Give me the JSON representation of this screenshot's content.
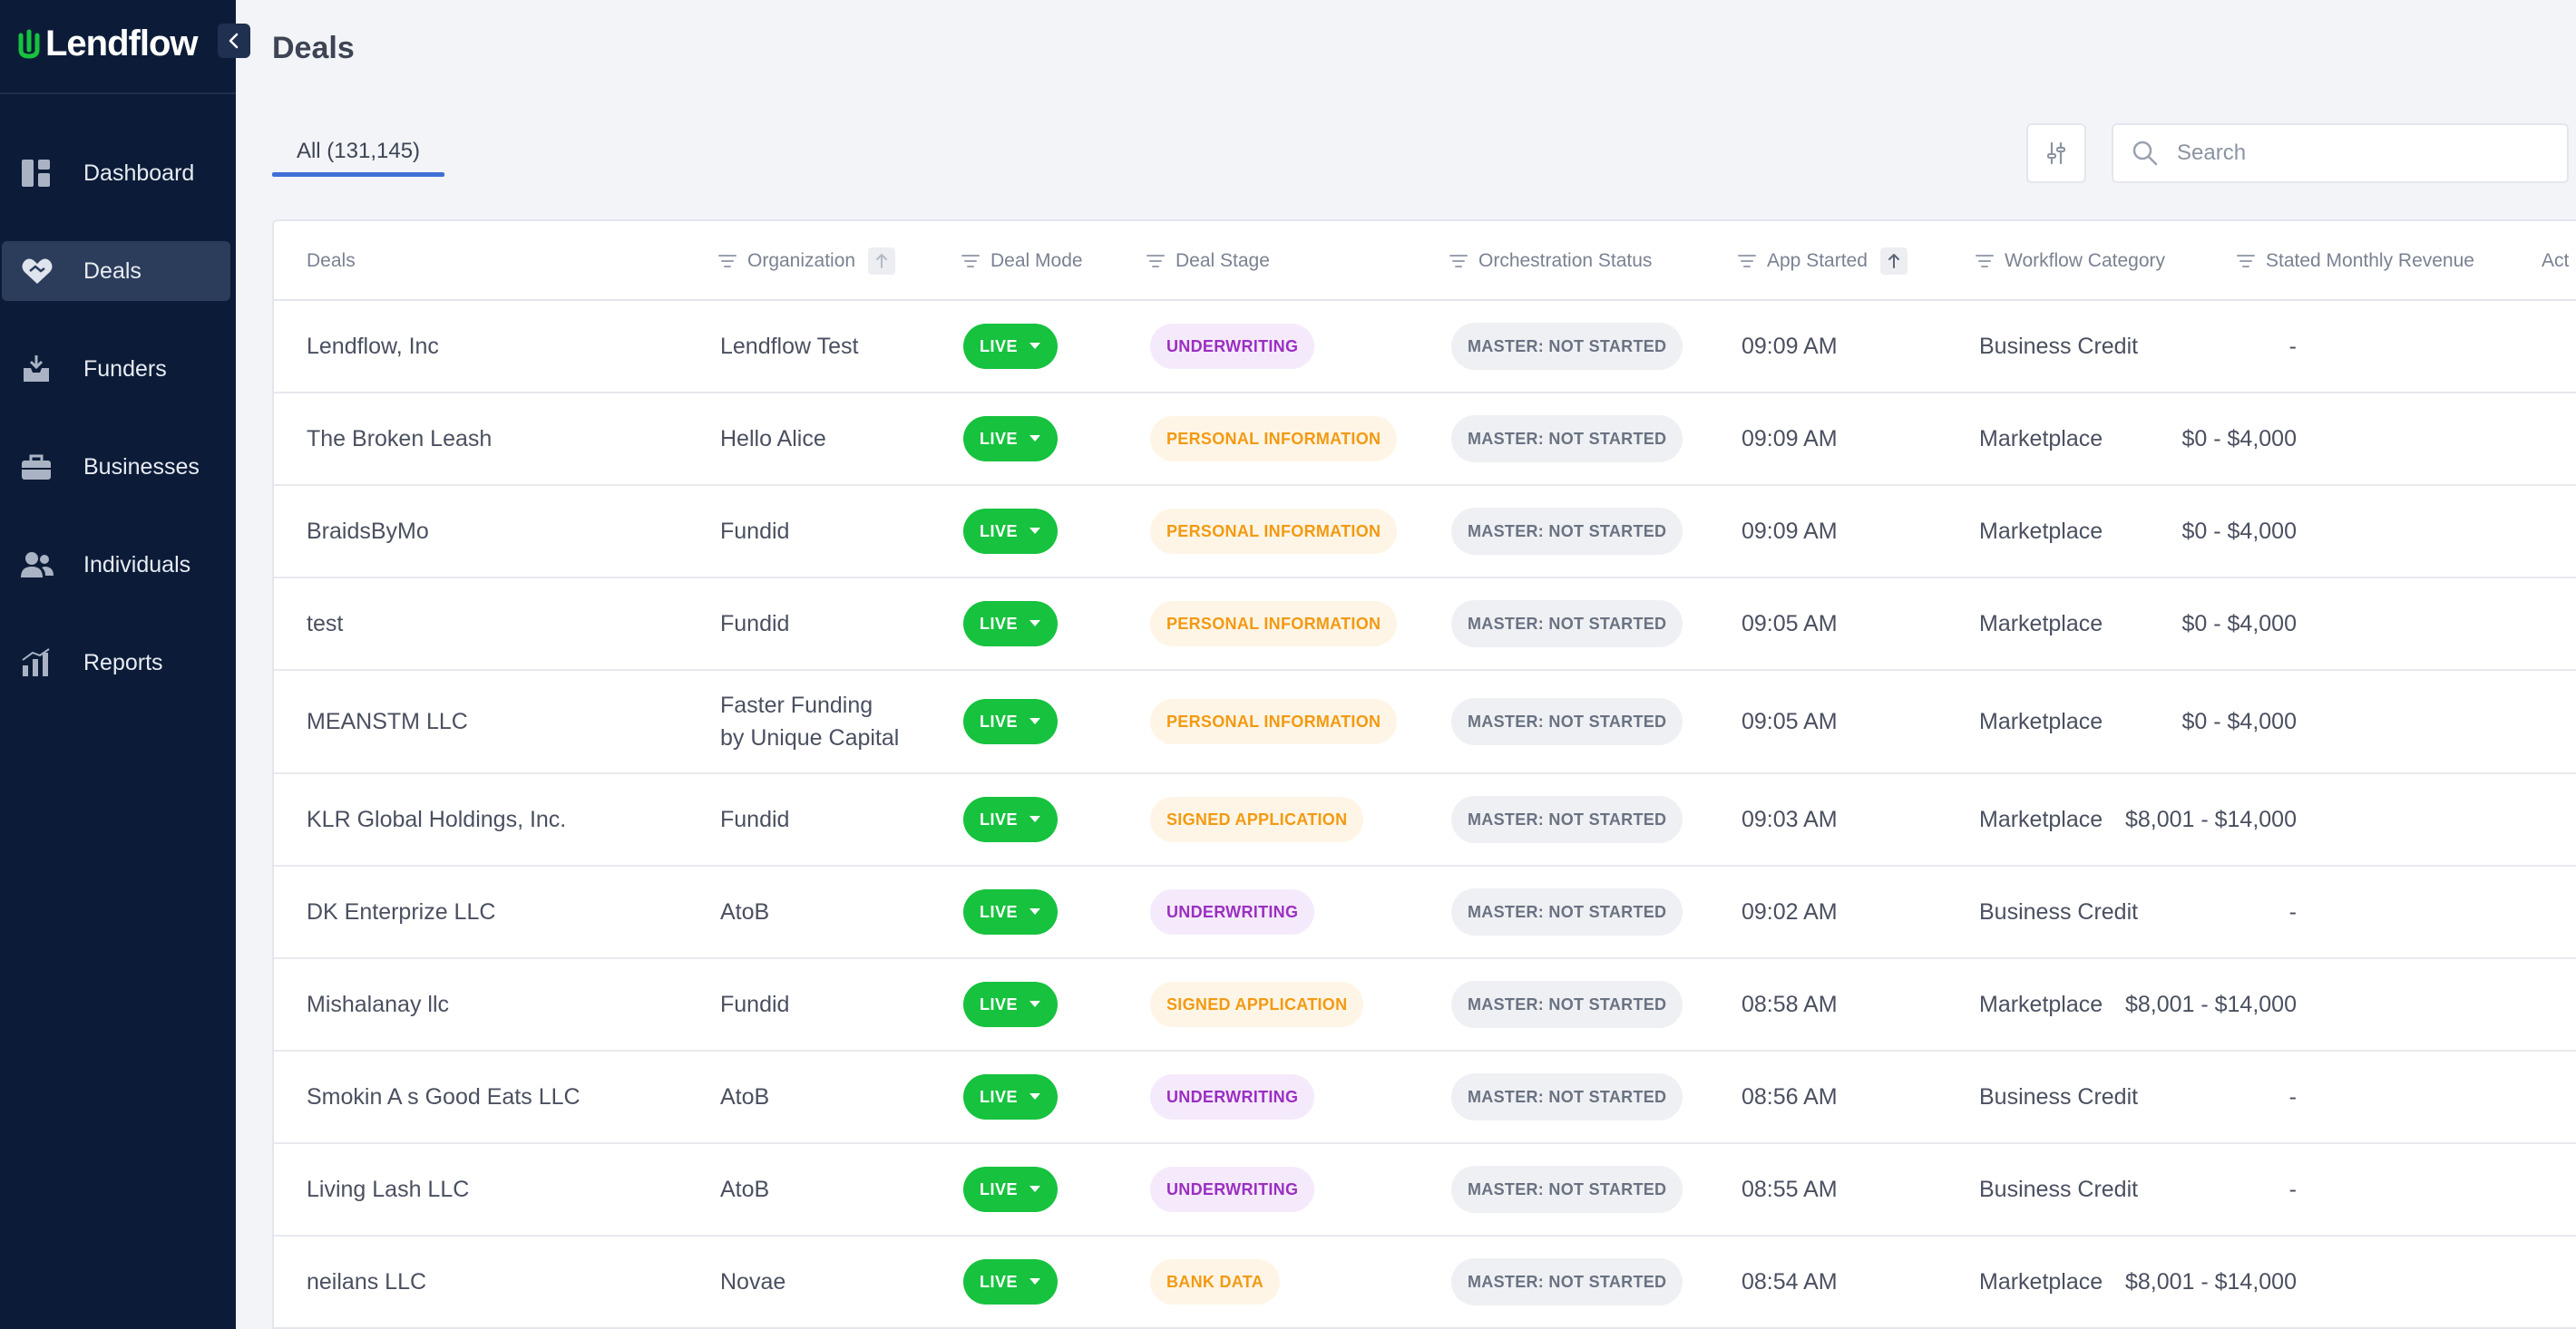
{
  "sidebar": {
    "brand": "Lendflow",
    "items": [
      {
        "label": "Dashboard",
        "icon": "dashboard-icon"
      },
      {
        "label": "Deals",
        "icon": "handshake-icon",
        "active": true
      },
      {
        "label": "Funders",
        "icon": "inbox-icon"
      },
      {
        "label": "Businesses",
        "icon": "briefcase-icon"
      },
      {
        "label": "Individuals",
        "icon": "users-icon"
      },
      {
        "label": "Reports",
        "icon": "bar-chart-icon"
      }
    ]
  },
  "header": {
    "title": "Deals"
  },
  "tabs": [
    {
      "label": "All (131,145)",
      "active": true
    }
  ],
  "search": {
    "placeholder": "Search",
    "value": ""
  },
  "table": {
    "columns": [
      "Deals",
      "Organization",
      "Deal Mode",
      "Deal Stage",
      "Orchestration Status",
      "App Started",
      "Workflow Category",
      "Stated Monthly Revenue",
      "Act"
    ],
    "rows": [
      {
        "deal": "Lendflow, Inc",
        "org": "Lendflow Test",
        "mode": "LIVE",
        "stage": "UNDERWRITING",
        "stage_color": "purple",
        "orch": "MASTER: NOT STARTED",
        "started": "09:09 AM",
        "category": "Business Credit",
        "revenue": "-"
      },
      {
        "deal": "The Broken Leash",
        "org": "Hello Alice",
        "mode": "LIVE",
        "stage": "PERSONAL INFORMATION",
        "stage_color": "orange",
        "orch": "MASTER: NOT STARTED",
        "started": "09:09 AM",
        "category": "Marketplace",
        "revenue": "$0 - $4,000"
      },
      {
        "deal": "BraidsByMo",
        "org": "Fundid",
        "mode": "LIVE",
        "stage": "PERSONAL INFORMATION",
        "stage_color": "orange",
        "orch": "MASTER: NOT STARTED",
        "started": "09:09 AM",
        "category": "Marketplace",
        "revenue": "$0 - $4,000"
      },
      {
        "deal": "test",
        "org": "Fundid",
        "mode": "LIVE",
        "stage": "PERSONAL INFORMATION",
        "stage_color": "orange",
        "orch": "MASTER: NOT STARTED",
        "started": "09:05 AM",
        "category": "Marketplace",
        "revenue": "$0 - $4,000"
      },
      {
        "deal": "MEANSTM LLC",
        "org": "Faster Funding by Unique Capital",
        "mode": "LIVE",
        "stage": "PERSONAL INFORMATION",
        "stage_color": "orange",
        "orch": "MASTER: NOT STARTED",
        "started": "09:05 AM",
        "category": "Marketplace",
        "revenue": "$0 - $4,000"
      },
      {
        "deal": "KLR Global Holdings, Inc.",
        "org": "Fundid",
        "mode": "LIVE",
        "stage": "SIGNED APPLICATION",
        "stage_color": "orange",
        "orch": "MASTER: NOT STARTED",
        "started": "09:03 AM",
        "category": "Marketplace",
        "revenue": "$8,001 - $14,000"
      },
      {
        "deal": "DK Enterprize LLC",
        "org": "AtoB",
        "mode": "LIVE",
        "stage": "UNDERWRITING",
        "stage_color": "purple",
        "orch": "MASTER: NOT STARTED",
        "started": "09:02 AM",
        "category": "Business Credit",
        "revenue": "-"
      },
      {
        "deal": "Mishalanay llc",
        "org": "Fundid",
        "mode": "LIVE",
        "stage": "SIGNED APPLICATION",
        "stage_color": "orange",
        "orch": "MASTER: NOT STARTED",
        "started": "08:58 AM",
        "category": "Marketplace",
        "revenue": "$8,001 - $14,000"
      },
      {
        "deal": "Smokin A s Good Eats LLC",
        "org": "AtoB",
        "mode": "LIVE",
        "stage": "UNDERWRITING",
        "stage_color": "purple",
        "orch": "MASTER: NOT STARTED",
        "started": "08:56 AM",
        "category": "Business Credit",
        "revenue": "-"
      },
      {
        "deal": "Living Lash LLC",
        "org": "AtoB",
        "mode": "LIVE",
        "stage": "UNDERWRITING",
        "stage_color": "purple",
        "orch": "MASTER: NOT STARTED",
        "started": "08:55 AM",
        "category": "Business Credit",
        "revenue": "-"
      },
      {
        "deal": "neilans LLC",
        "org": "Novae",
        "mode": "LIVE",
        "stage": "BANK DATA",
        "stage_color": "orange",
        "orch": "MASTER: NOT STARTED",
        "started": "08:54 AM",
        "category": "Marketplace",
        "revenue": "$8,001 - $14,000"
      }
    ]
  },
  "colors": {
    "sidebar_bg": "#0c1c38",
    "accent": "#3f6ed6",
    "brand_green": "#16c23e",
    "live_green": "#16c23e",
    "stage_purple": "#9b2fc2",
    "stage_orange": "#f29a12"
  }
}
